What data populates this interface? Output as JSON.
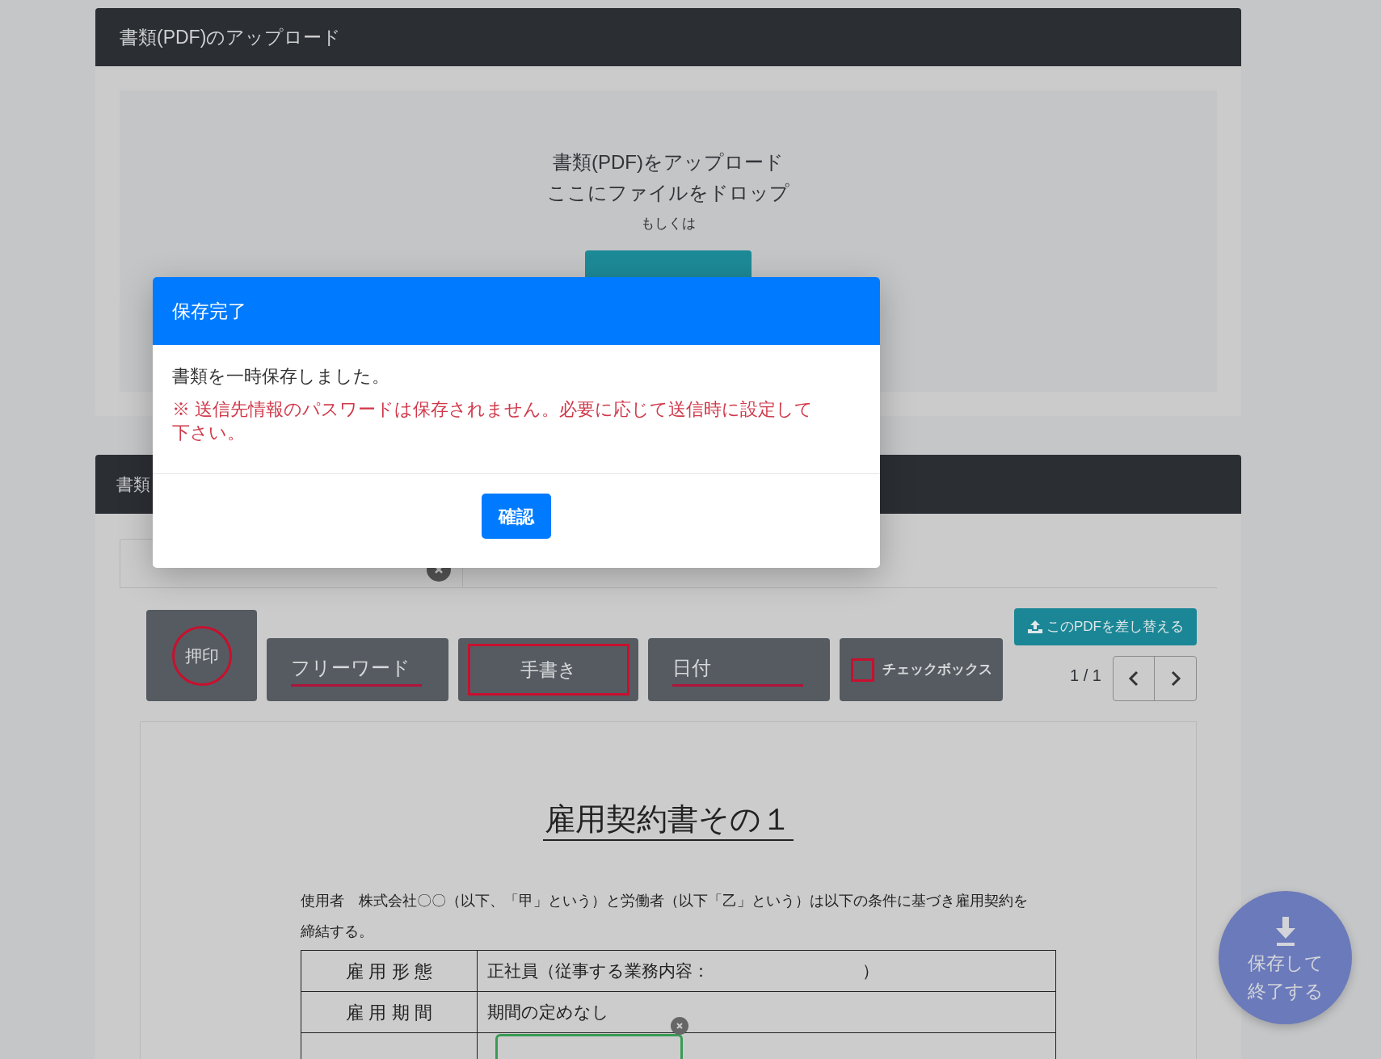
{
  "upload_card": {
    "title": "書類(PDF)のアップロード",
    "dropzone": {
      "lines": [
        "書類(PDF)をアップロード",
        "ここにファイルをドロップ"
      ],
      "or": "もしくは"
    }
  },
  "dialog": {
    "title": "保存完了",
    "message": "書類を一時保存しました。",
    "warning": "※ 送信先情報のパスワードは保存されません。必要に応じて送信時に設定して下さい。",
    "button": "確認"
  },
  "editor_card": {
    "title": "書類",
    "tools": [
      {
        "kind": "stamp",
        "label": "押印"
      },
      {
        "kind": "text",
        "label": "フリーワード"
      },
      {
        "kind": "handwriting",
        "label": "手書き"
      },
      {
        "kind": "date",
        "label": "日付"
      },
      {
        "kind": "checkbox",
        "label": "チェックボックス"
      }
    ],
    "replace_button": "このPDFを差し替える",
    "page_indicator": "1 / 1"
  },
  "document": {
    "title": "雇用契約書その１",
    "intro": "使用者　株式会社〇〇（以下、「甲」という）と労働者（以下「乙」という）は以下の条件に基づき雇用契約を締結する。",
    "rows": [
      {
        "label": "雇 用 形 態",
        "value": "正社員（従事する業務内容：　　　　　　　　　）"
      },
      {
        "label": "雇 用 期 間",
        "value": "期間の定めなし"
      }
    ]
  },
  "fab": {
    "label_lines": [
      "保存して",
      "終了する"
    ]
  }
}
